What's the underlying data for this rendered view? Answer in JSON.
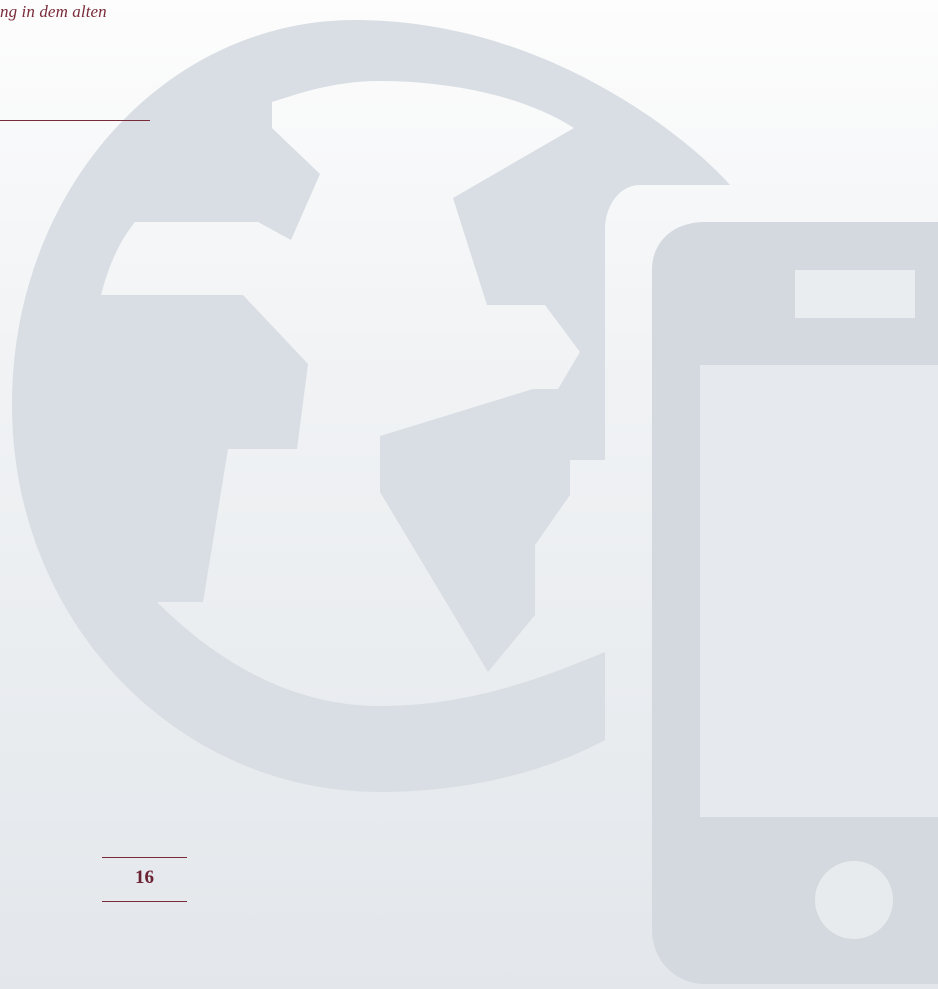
{
  "header": {
    "running_text": "ng in dem alten"
  },
  "footer": {
    "page_number": "16"
  },
  "colors": {
    "accent": "#7a2b39",
    "graphic": "#d6dce2",
    "background": "#f3f5f7"
  },
  "icons": {
    "globe": "globe-icon",
    "smartphone": "smartphone-icon"
  }
}
